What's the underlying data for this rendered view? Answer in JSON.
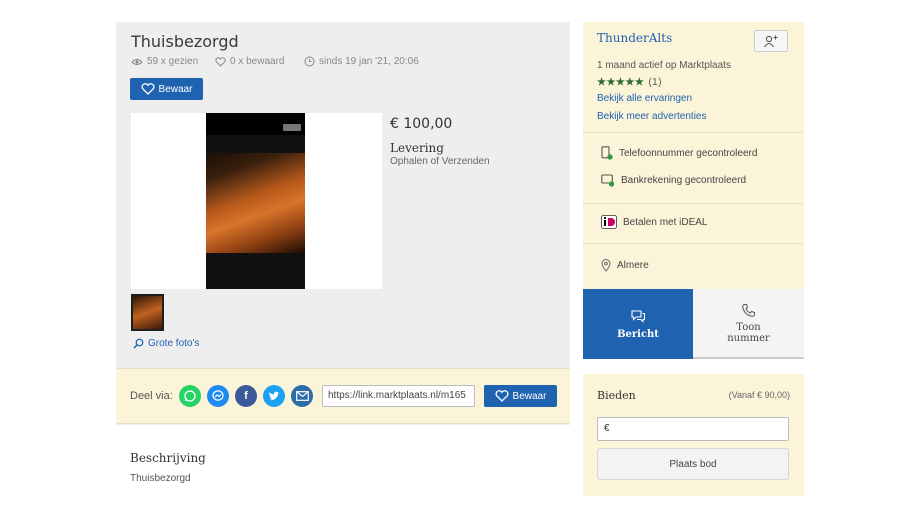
{
  "listing": {
    "title": "Thuisbezorgd",
    "views": "59 x gezien",
    "saved": "0 x bewaard",
    "since": "sinds 19 jan '21, 20:06",
    "save_label": "Bewaar",
    "price": "€ 100,00",
    "delivery_label": "Levering",
    "delivery_value": "Ophalen of Verzenden",
    "large_photos_label": "Grote foto's"
  },
  "share": {
    "label": "Deel via:",
    "networks": [
      "whatsapp-icon",
      "messenger-icon",
      "facebook-icon",
      "twitter-icon",
      "email-icon"
    ],
    "link_value": "https://link.marktplaats.nl/m165",
    "save_label": "Bewaar"
  },
  "description": {
    "heading": "Beschrijving",
    "text": "Thuisbezorgd"
  },
  "seller": {
    "name": "ThunderAlts",
    "active": "1 maand actief op Marktplaats",
    "stars": "★★★★★",
    "rating_count": "(1)",
    "reviews_link": "Bekijk alle ervaringen",
    "more_ads_link": "Bekijk meer advertenties",
    "phone_verified": "Telefoonnummer gecontroleerd",
    "bank_verified": "Bankrekening gecontroleerd",
    "ideal": "Betalen met iDEAL",
    "location": "Almere"
  },
  "actions": {
    "message_label": "Bericht",
    "show_number_line1": "Toon",
    "show_number_line2": "nummer"
  },
  "bid": {
    "label": "Bieden",
    "from": "(Vanaf € 90,00)",
    "currency": "€",
    "place_bid_label": "Plaats bod"
  },
  "colors": {
    "accent": "#1f62b0",
    "panel": "#fbf4d9",
    "whatsapp": "#25d366",
    "messenger": "#1f8bf2",
    "facebook": "#3b5998",
    "twitter": "#1da1f2",
    "email": "#2c6ca8"
  }
}
